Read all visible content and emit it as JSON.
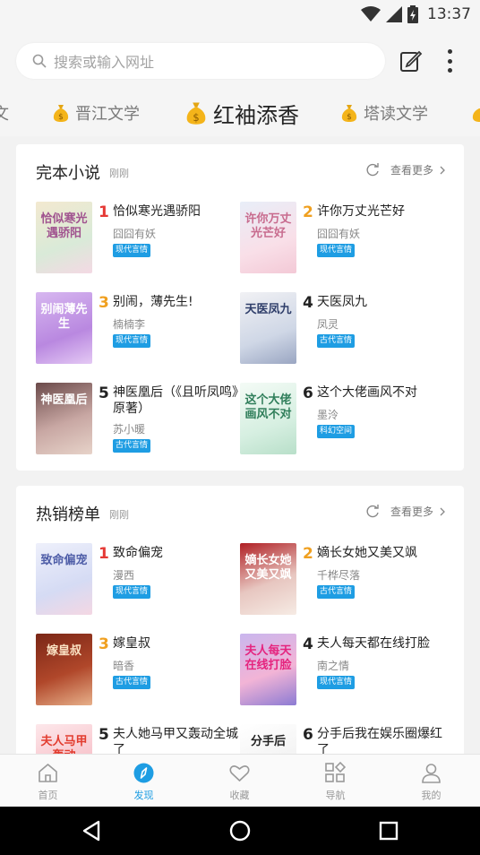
{
  "status_bar": {
    "time": "13:37"
  },
  "search": {
    "placeholder": "搜索或输入网址"
  },
  "site_tabs": [
    {
      "label": "文",
      "active": false
    },
    {
      "label": "晋江文学",
      "active": false
    },
    {
      "label": "红袖添香",
      "active": true
    },
    {
      "label": "塔读文学",
      "active": false
    }
  ],
  "sections": [
    {
      "title": "完本小说",
      "subtitle": "刚刚",
      "more": "查看更多",
      "books": [
        {
          "rank": "1",
          "title": "恰似寒光遇骄阳",
          "author": "囧囧有妖",
          "tag": "现代言情",
          "cover_text": "恰似寒光遇骄阳"
        },
        {
          "rank": "2",
          "title": "许你万丈光芒好",
          "author": "囧囧有妖",
          "tag": "现代言情",
          "cover_text": "许你万丈光芒好"
        },
        {
          "rank": "3",
          "title": "别闹，薄先生!",
          "author": "楠楠李",
          "tag": "现代言情",
          "cover_text": "别闹薄先生"
        },
        {
          "rank": "4",
          "title": "天医凤九",
          "author": "凤灵",
          "tag": "古代言情",
          "cover_text": "天医凤九"
        },
        {
          "rank": "5",
          "title": "神医凰后（《且听凤鸣》原著）",
          "author": "苏小暖",
          "tag": "古代言情",
          "cover_text": "神医凰后"
        },
        {
          "rank": "6",
          "title": "这个大佬画风不对",
          "author": "墨泠",
          "tag": "科幻空间",
          "cover_text": "这个大佬画风不对"
        }
      ]
    },
    {
      "title": "热销榜单",
      "subtitle": "刚刚",
      "more": "查看更多",
      "books": [
        {
          "rank": "1",
          "title": "致命偏宠",
          "author": "漫西",
          "tag": "现代言情",
          "cover_text": "致命偏宠"
        },
        {
          "rank": "2",
          "title": "嫡长女她又美又飒",
          "author": "千桦尽落",
          "tag": "古代言情",
          "cover_text": "嫡长女她又美又飒"
        },
        {
          "rank": "3",
          "title": "嫁皇叔",
          "author": "暗香",
          "tag": "古代言情",
          "cover_text": "嫁皇叔"
        },
        {
          "rank": "4",
          "title": "夫人每天都在线打脸",
          "author": "南之情",
          "tag": "现代言情",
          "cover_text": "夫人每天在线打脸"
        },
        {
          "rank": "5",
          "title": "夫人她马甲又轰动全城了",
          "author": "",
          "tag": "",
          "cover_text": "夫人马甲轰动"
        },
        {
          "rank": "6",
          "title": "分手后我在娱乐圈爆红了",
          "author": "",
          "tag": "",
          "cover_text": "分手后"
        }
      ]
    }
  ],
  "bottom_tabs": [
    {
      "label": "首页",
      "icon": "home-icon",
      "active": false
    },
    {
      "label": "发现",
      "icon": "compass-icon",
      "active": true
    },
    {
      "label": "收藏",
      "icon": "heart-icon",
      "active": false
    },
    {
      "label": "导航",
      "icon": "grid-icon",
      "active": false
    },
    {
      "label": "我的",
      "icon": "person-icon",
      "active": false
    }
  ],
  "colors": {
    "accent": "#1e9de3",
    "rank_top": "#e53935",
    "rank_second": "#f0a020",
    "tag_bg": "#1e9de3"
  }
}
